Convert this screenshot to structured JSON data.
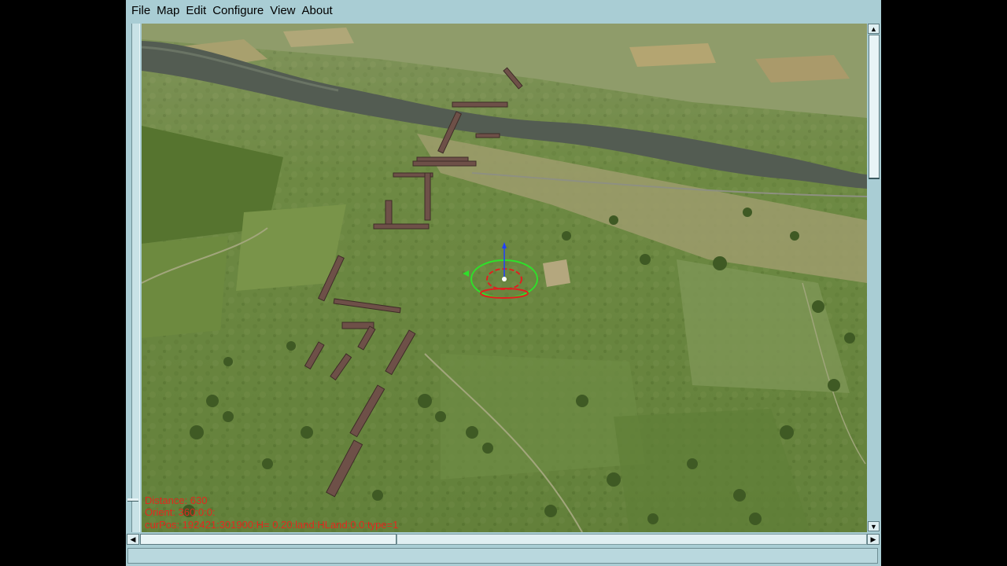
{
  "menu": {
    "items": [
      "File",
      "Map",
      "Edit",
      "Configure",
      "View",
      "About"
    ]
  },
  "overlay": {
    "distance": "Distance: 630",
    "orient": "Orient: 360:0:0:",
    "curpos": "curPos: 192421:301900:H= 0.20:land:HLand:0.0:type=1"
  },
  "scene": {
    "description_icon": "terrain-3d-view",
    "cursor_icon": "target-cursor-icon",
    "colors": {
      "text_overlay": "#e3281e",
      "cursor_ring": "#2ee02a",
      "cursor_ring_inner": "#e02020",
      "axis_blue": "#2040ff"
    }
  },
  "scrollbars": {
    "vertical_icon_up": "arrow-up-icon",
    "vertical_icon_down": "arrow-down-icon",
    "horizontal_icon_left": "arrow-left-icon",
    "horizontal_icon_right": "arrow-right-icon"
  }
}
